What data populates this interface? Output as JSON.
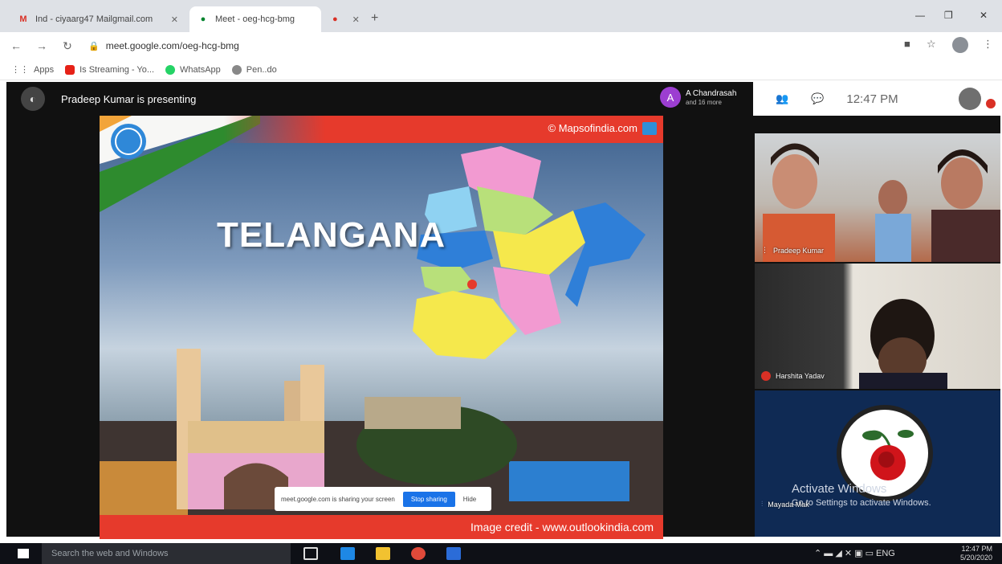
{
  "browser": {
    "tabs": [
      {
        "icon": "gmail-icon",
        "label": "Ind - ciyaarg47 Mailgmail.com",
        "active": false
      },
      {
        "icon": "meet-icon",
        "label": "Meet - oeg-hcg-bmg",
        "active": true
      },
      {
        "icon": "record-icon",
        "label": "",
        "active": false
      }
    ],
    "url": "meet.google.com/oeg-hcg-bmg",
    "bookmarks": [
      "Apps",
      "Is Streaming - Yo...",
      "WhatsApp",
      "Pen..do"
    ]
  },
  "meet": {
    "presenting_text": "Pradeep Kumar is presenting",
    "user_chip": {
      "initial": "A",
      "name": "A Chandrasah",
      "sub": "and 16 more"
    },
    "clock": "12:47 PM",
    "participants": [
      {
        "name": "Pradeep Kumar"
      },
      {
        "name": "Harshita Yadav"
      },
      {
        "name": "Mayada Mak"
      }
    ],
    "watermark": {
      "title": "Activate Windows",
      "sub": "Go to Settings to activate Windows."
    }
  },
  "slide": {
    "watermark_top": "© Mapsofindia.com",
    "title": "TELANGANA",
    "credit": "Image credit - www.outlookindia.com",
    "share_bar": {
      "text": "meet.google.com is sharing your screen",
      "stop": "Stop sharing",
      "hide": "Hide"
    }
  },
  "taskbar": {
    "search_placeholder": "Search the web and Windows",
    "tray_lang": "ENG",
    "time": "12:47 PM",
    "date": "5/20/2020"
  },
  "colors": {
    "accent_red": "#e63a2c",
    "meet_blue": "#1a73e8",
    "avatar_purple": "#9c3ed1"
  }
}
